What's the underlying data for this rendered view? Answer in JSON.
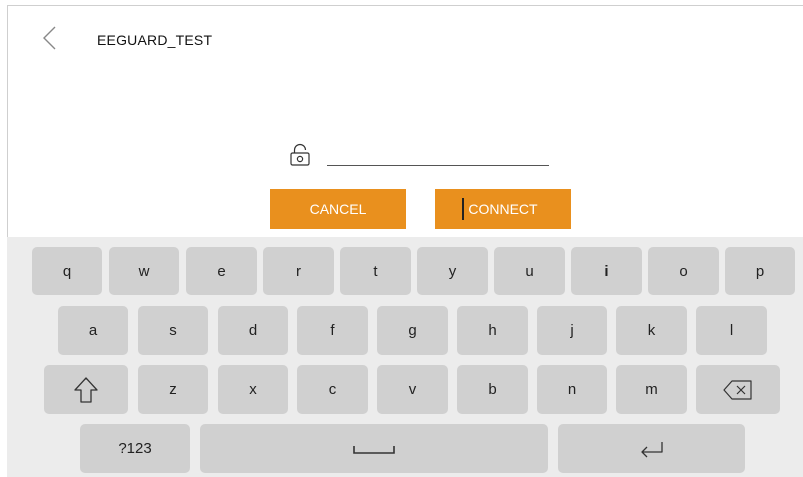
{
  "header": {
    "back_icon": "chevron-left-icon",
    "title": "EEGUARD_TEST"
  },
  "password": {
    "icon": "lock-icon",
    "value": "",
    "placeholder": ""
  },
  "buttons": {
    "cancel_label": "CANCEL",
    "connect_label": "CONNECT"
  },
  "keyboard": {
    "row1": [
      "q",
      "w",
      "e",
      "r",
      "t",
      "y",
      "u",
      "i",
      "o",
      "p"
    ],
    "row2": [
      "a",
      "s",
      "d",
      "f",
      "g",
      "h",
      "j",
      "k",
      "l"
    ],
    "row3": [
      "z",
      "x",
      "c",
      "v",
      "b",
      "n",
      "m"
    ],
    "shift_icon": "shift-arrow-icon",
    "backspace_icon": "backspace-icon",
    "symbols_label": "?123",
    "space_icon": "space-bar-icon",
    "enter_icon": "enter-return-icon"
  },
  "colors": {
    "accent": "#e9901e",
    "key": "#d0d0d0",
    "keyboard_bg": "#ececec"
  }
}
